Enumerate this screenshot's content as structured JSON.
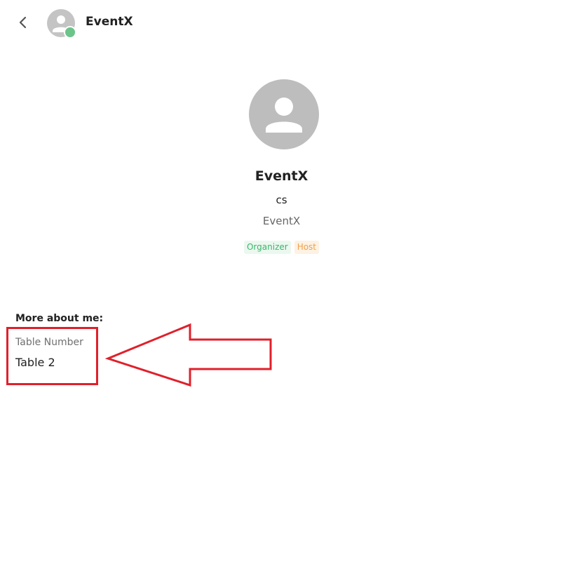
{
  "header": {
    "back_icon": "chevron-left-icon",
    "avatar_icon": "user-icon",
    "title": "EventX"
  },
  "profile": {
    "avatar_icon": "user-icon",
    "name": "EventX",
    "subtitle": "cs",
    "company": "EventX",
    "roles": [
      {
        "label": "Organizer",
        "color": "#3bb56c"
      },
      {
        "label": "Host",
        "color": "#f0a04b"
      }
    ]
  },
  "about": {
    "heading": "More about me:",
    "fields": [
      {
        "label": "Table Number",
        "value": "Table 2"
      }
    ]
  },
  "annotation": {
    "type": "arrow",
    "color": "#e0202b"
  },
  "colors": {
    "online_status": "#6cc48a",
    "avatar_bg": "#bdbdbd"
  }
}
